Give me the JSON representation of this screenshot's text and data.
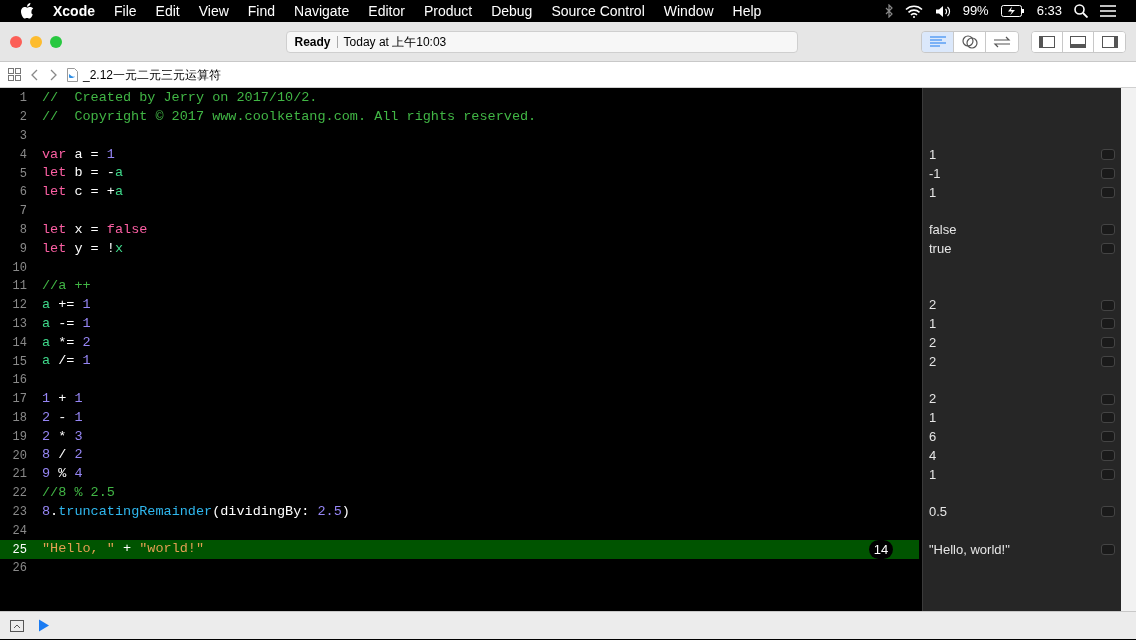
{
  "menu_bar": {
    "app": "Xcode",
    "menus": [
      "File",
      "Edit",
      "View",
      "Find",
      "Navigate",
      "Editor",
      "Product",
      "Debug",
      "Source Control",
      "Window",
      "Help"
    ],
    "battery": "99%",
    "time": "6:33"
  },
  "toolbar": {
    "status": "Ready",
    "timestamp": "Today at 上午10:03",
    "editor_modes": [
      {
        "kind": "standard",
        "selected": true
      },
      {
        "kind": "assistant",
        "selected": false
      },
      {
        "kind": "version",
        "selected": false
      }
    ],
    "panel_toggles": [
      {
        "kind": "navigator",
        "selected": false
      },
      {
        "kind": "debug",
        "selected": false
      },
      {
        "kind": "utilities",
        "selected": false
      }
    ]
  },
  "jump_bar": {
    "file": "_2.12一元二元三元运算符"
  },
  "editor": {
    "lines": [
      {
        "number": "1",
        "highlighted": false,
        "tokens": [
          {
            "kind": "comment",
            "text": "//  Created by Jerry on 2017/10/2."
          }
        ]
      },
      {
        "number": "2",
        "highlighted": false,
        "tokens": [
          {
            "kind": "comment",
            "text": "//  Copyright © 2017 www.coolketang.com. All rights reserved."
          }
        ]
      },
      {
        "number": "3",
        "highlighted": false
      },
      {
        "number": "4",
        "highlighted": false,
        "result": "1",
        "tokens": [
          {
            "kind": "keyword",
            "text": "var"
          },
          {
            "kind": "plain",
            "text": " a = "
          },
          {
            "kind": "number",
            "text": "1"
          }
        ]
      },
      {
        "number": "5",
        "highlighted": false,
        "result": "-1",
        "tokens": [
          {
            "kind": "keyword",
            "text": "let"
          },
          {
            "kind": "plain",
            "text": " b = -"
          },
          {
            "kind": "ident",
            "text": "a"
          }
        ]
      },
      {
        "number": "6",
        "highlighted": false,
        "result": "1",
        "tokens": [
          {
            "kind": "keyword",
            "text": "let"
          },
          {
            "kind": "plain",
            "text": " c = +"
          },
          {
            "kind": "ident",
            "text": "a"
          }
        ]
      },
      {
        "number": "7",
        "highlighted": false
      },
      {
        "number": "8",
        "highlighted": false,
        "result": "false",
        "tokens": [
          {
            "kind": "keyword",
            "text": "let"
          },
          {
            "kind": "plain",
            "text": " x = "
          },
          {
            "kind": "keyword",
            "text": "false"
          }
        ]
      },
      {
        "number": "9",
        "highlighted": false,
        "result": "true",
        "tokens": [
          {
            "kind": "keyword",
            "text": "let"
          },
          {
            "kind": "plain",
            "text": " y = !"
          },
          {
            "kind": "ident",
            "text": "x"
          }
        ]
      },
      {
        "number": "10",
        "highlighted": false
      },
      {
        "number": "11",
        "highlighted": false,
        "tokens": [
          {
            "kind": "comment",
            "text": "//a ++"
          }
        ]
      },
      {
        "number": "12",
        "highlighted": false,
        "result": "2",
        "tokens": [
          {
            "kind": "ident",
            "text": "a"
          },
          {
            "kind": "plain",
            "text": " += "
          },
          {
            "kind": "number",
            "text": "1"
          }
        ]
      },
      {
        "number": "13",
        "highlighted": false,
        "result": "1",
        "tokens": [
          {
            "kind": "ident",
            "text": "a"
          },
          {
            "kind": "plain",
            "text": " -= "
          },
          {
            "kind": "number",
            "text": "1"
          }
        ]
      },
      {
        "number": "14",
        "highlighted": false,
        "result": "2",
        "tokens": [
          {
            "kind": "ident",
            "text": "a"
          },
          {
            "kind": "plain",
            "text": " *= "
          },
          {
            "kind": "number",
            "text": "2"
          }
        ]
      },
      {
        "number": "15",
        "highlighted": false,
        "result": "2",
        "tokens": [
          {
            "kind": "ident",
            "text": "a"
          },
          {
            "kind": "plain",
            "text": " /= "
          },
          {
            "kind": "number",
            "text": "1"
          }
        ]
      },
      {
        "number": "16",
        "highlighted": false
      },
      {
        "number": "17",
        "highlighted": false,
        "result": "2",
        "tokens": [
          {
            "kind": "number",
            "text": "1"
          },
          {
            "kind": "plain",
            "text": " + "
          },
          {
            "kind": "number",
            "text": "1"
          }
        ]
      },
      {
        "number": "18",
        "highlighted": false,
        "result": "1",
        "tokens": [
          {
            "kind": "number",
            "text": "2"
          },
          {
            "kind": "plain",
            "text": " - "
          },
          {
            "kind": "number",
            "text": "1"
          }
        ]
      },
      {
        "number": "19",
        "highlighted": false,
        "result": "6",
        "tokens": [
          {
            "kind": "number",
            "text": "2"
          },
          {
            "kind": "plain",
            "text": " * "
          },
          {
            "kind": "number",
            "text": "3"
          }
        ]
      },
      {
        "number": "20",
        "highlighted": false,
        "result": "4",
        "tokens": [
          {
            "kind": "number",
            "text": "8"
          },
          {
            "kind": "plain",
            "text": " / "
          },
          {
            "kind": "number",
            "text": "2"
          }
        ]
      },
      {
        "number": "21",
        "highlighted": false,
        "result": "1",
        "tokens": [
          {
            "kind": "number",
            "text": "9"
          },
          {
            "kind": "plain",
            "text": " % "
          },
          {
            "kind": "number",
            "text": "4"
          }
        ]
      },
      {
        "number": "22",
        "highlighted": false,
        "tokens": [
          {
            "kind": "comment",
            "text": "//8 % 2.5"
          }
        ]
      },
      {
        "number": "23",
        "highlighted": false,
        "result": "0.5",
        "tokens": [
          {
            "kind": "number",
            "text": "8"
          },
          {
            "kind": "plain",
            "text": "."
          },
          {
            "kind": "method",
            "text": "truncatingRemainder"
          },
          {
            "kind": "plain",
            "text": "(dividingBy: "
          },
          {
            "kind": "number",
            "text": "2.5"
          },
          {
            "kind": "plain",
            "text": ")"
          }
        ]
      },
      {
        "number": "24",
        "highlighted": false
      },
      {
        "number": "25",
        "highlighted": true,
        "badge": "14",
        "result": "\"Hello, world!\"",
        "tokens": [
          {
            "kind": "string",
            "text": "\"Hello, \""
          },
          {
            "kind": "plain",
            "text": " + "
          },
          {
            "kind": "string",
            "text": "\"world!\""
          }
        ]
      },
      {
        "number": "26",
        "highlighted": false
      }
    ]
  }
}
